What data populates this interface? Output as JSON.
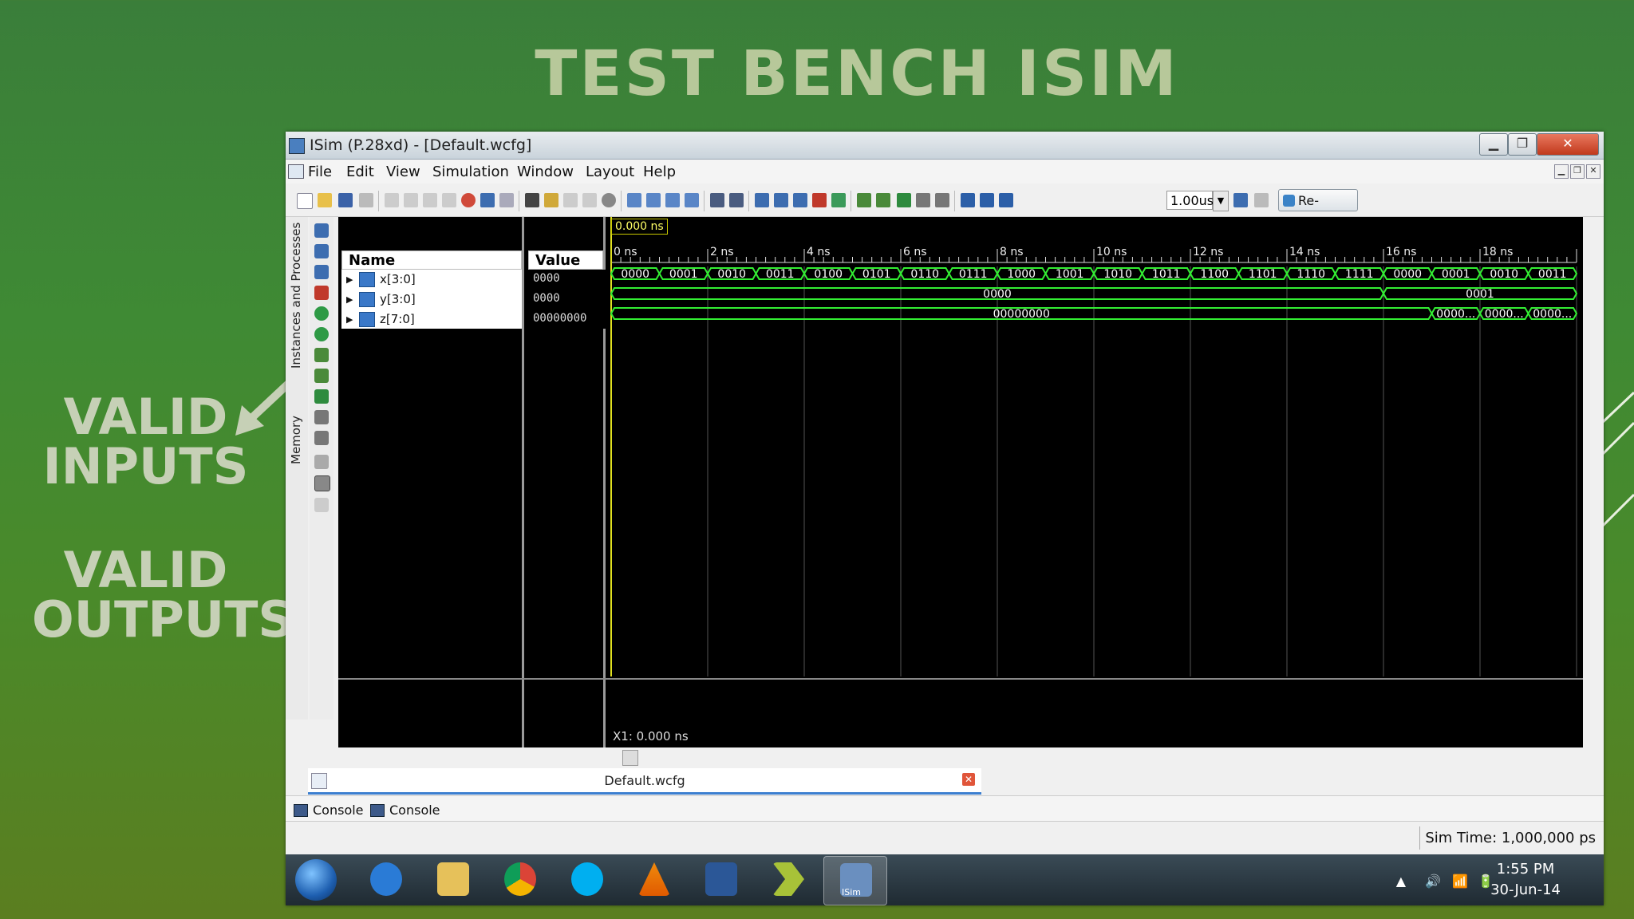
{
  "slide": {
    "title": "TEST BENCH ISIM",
    "label_inputs_1": "VALID",
    "label_inputs_2": "INPUTS",
    "label_outputs_1": "VALID",
    "label_outputs_2": "OUTPUTS"
  },
  "window": {
    "title": "ISim (P.28xd) - [Default.wcfg]",
    "min": "▁",
    "max": "❐",
    "close": "✕"
  },
  "menu": [
    "File",
    "Edit",
    "View",
    "Simulation",
    "Window",
    "Layout",
    "Help"
  ],
  "toolbar": {
    "run_time": "1.00us",
    "relaunch": "Re-launch"
  },
  "side_tabs": {
    "instances": "Instances and Processes",
    "memory": "Memory"
  },
  "wave": {
    "name_header": "Name",
    "value_header": "Value",
    "cursor_time": "0.000 ns",
    "x1_label": "X1: 0.000 ns",
    "time_ticks": [
      "0 ns",
      "2 ns",
      "4 ns",
      "6 ns",
      "8 ns",
      "10 ns",
      "12 ns",
      "14 ns",
      "16 ns",
      "18 ns"
    ],
    "signals": [
      {
        "name": "x[3:0]",
        "value": "0000"
      },
      {
        "name": "y[3:0]",
        "value": "0000"
      },
      {
        "name": "z[7:0]",
        "value": "00000000"
      }
    ],
    "x_segments": [
      "0000",
      "0001",
      "0010",
      "0011",
      "0100",
      "0101",
      "0110",
      "0111",
      "1000",
      "1001",
      "1010",
      "1011",
      "1100",
      "1101",
      "1110",
      "1111",
      "0000",
      "0001",
      "0010",
      "0011"
    ],
    "y_segments": [
      {
        "label": "0000",
        "start": 0,
        "end": 16
      },
      {
        "label": "0001",
        "start": 16,
        "end": 20
      }
    ],
    "z_segments": [
      {
        "label": "00000000",
        "start": 0,
        "end": 17
      },
      {
        "label": "0000...",
        "start": 17,
        "end": 18
      },
      {
        "label": "0000...",
        "start": 18,
        "end": 19
      },
      {
        "label": "0000...",
        "start": 19,
        "end": 20
      }
    ]
  },
  "doc_tab": {
    "name": "Default.wcfg",
    "close": "✕"
  },
  "console_tabs": [
    "Console",
    "Console"
  ],
  "status": {
    "sim_time": "Sim Time: 1,000,000 ps"
  },
  "taskbar": {
    "time": "1:55 PM",
    "date": "30-Jun-14",
    "isim_label": "ISim"
  }
}
